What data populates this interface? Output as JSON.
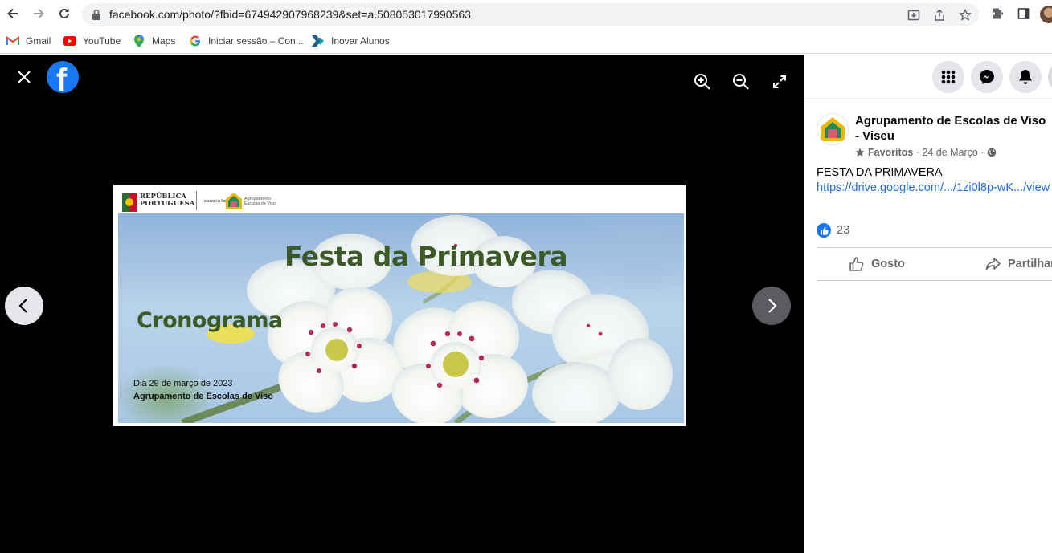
{
  "browser": {
    "url": "facebook.com/photo/?fbid=674942907968239&set=a.508053017990563",
    "bookmarks": [
      {
        "label": "Gmail",
        "icon": "gmail-icon"
      },
      {
        "label": "YouTube",
        "icon": "youtube-icon"
      },
      {
        "label": "Maps",
        "icon": "maps-icon"
      },
      {
        "label": "Iniciar sessão – Con...",
        "icon": "google-icon"
      },
      {
        "label": "Inovar Alunos",
        "icon": "inovar-icon"
      }
    ]
  },
  "viewer": {
    "photo": {
      "header_left": "REPÚBLICA PORTUGUESA",
      "header_left_line1": "REPÚBLICA",
      "header_left_line2": "PORTUGUESA",
      "header_edu": "EDUCAÇÃO",
      "header_school_line1": "Agrupamento",
      "header_school_line2": "Escolas de Viso",
      "title": "Festa da Primavera",
      "subtitle": "Cronograma",
      "date_line": "Dia 29 de março de 2023",
      "school_line": "Agrupamento de Escolas de Viso"
    }
  },
  "post": {
    "page_name": "Agrupamento de Escolas de Viso - Viseu",
    "meta_favorites": "Favoritos",
    "meta_date": "24 de Março",
    "text": "FESTA DA PRIMAVERA",
    "link": "https://drive.google.com/.../1zi0l8p-wK.../view",
    "likes_count": "23",
    "actions": {
      "like": "Gosto",
      "share": "Partilhar"
    }
  },
  "colors": {
    "facebook_blue": "#1877f2",
    "link_blue": "#216fdb",
    "title_green": "#3b5a26"
  }
}
